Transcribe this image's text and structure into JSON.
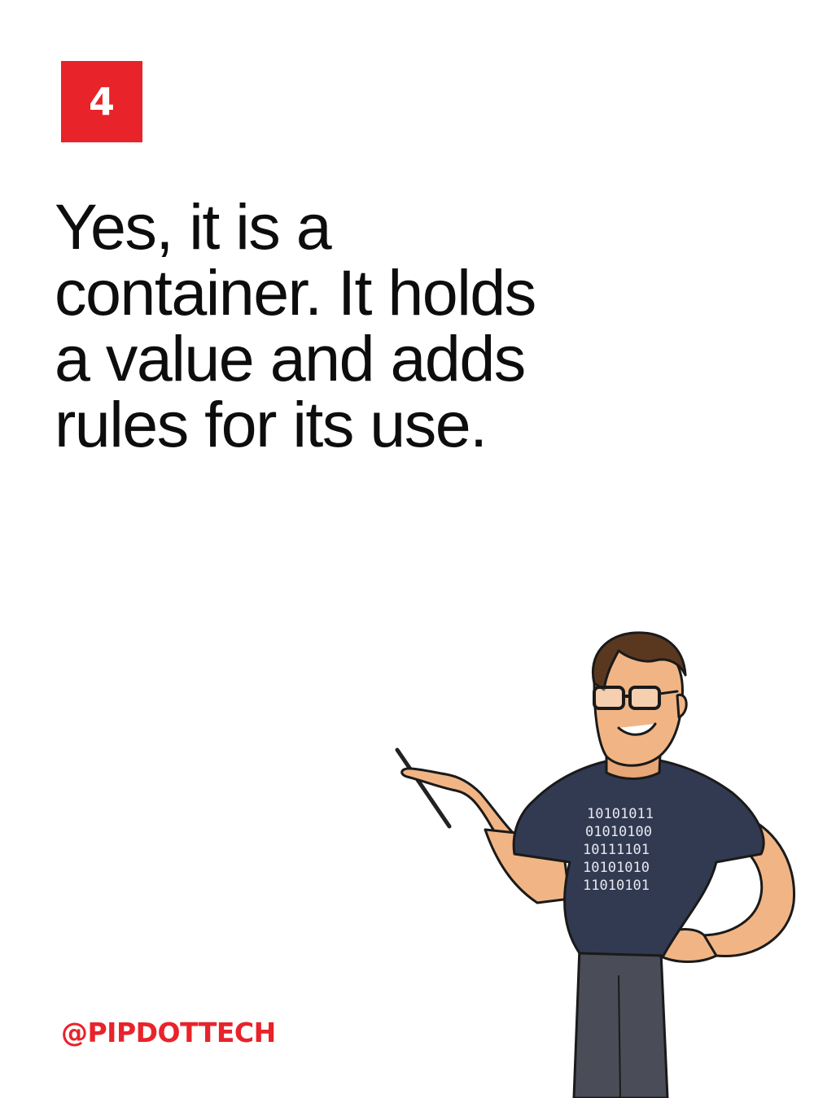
{
  "slide": {
    "number": "4",
    "headline_lines": [
      "Yes, it is a",
      "container. It holds",
      "a value and adds",
      "rules for its use."
    ],
    "handle": "@PIPDOTTECH",
    "shirt_binary": [
      "10101011",
      "01010100",
      "10111101",
      "10101010",
      "11010101"
    ]
  },
  "colors": {
    "accent": "#e8232a",
    "text": "#0d0d0d",
    "background": "#ffffff",
    "shirt": "#323a52",
    "skin": "#f1b585",
    "hair": "#5a3820",
    "pants": "#4a4d57"
  }
}
